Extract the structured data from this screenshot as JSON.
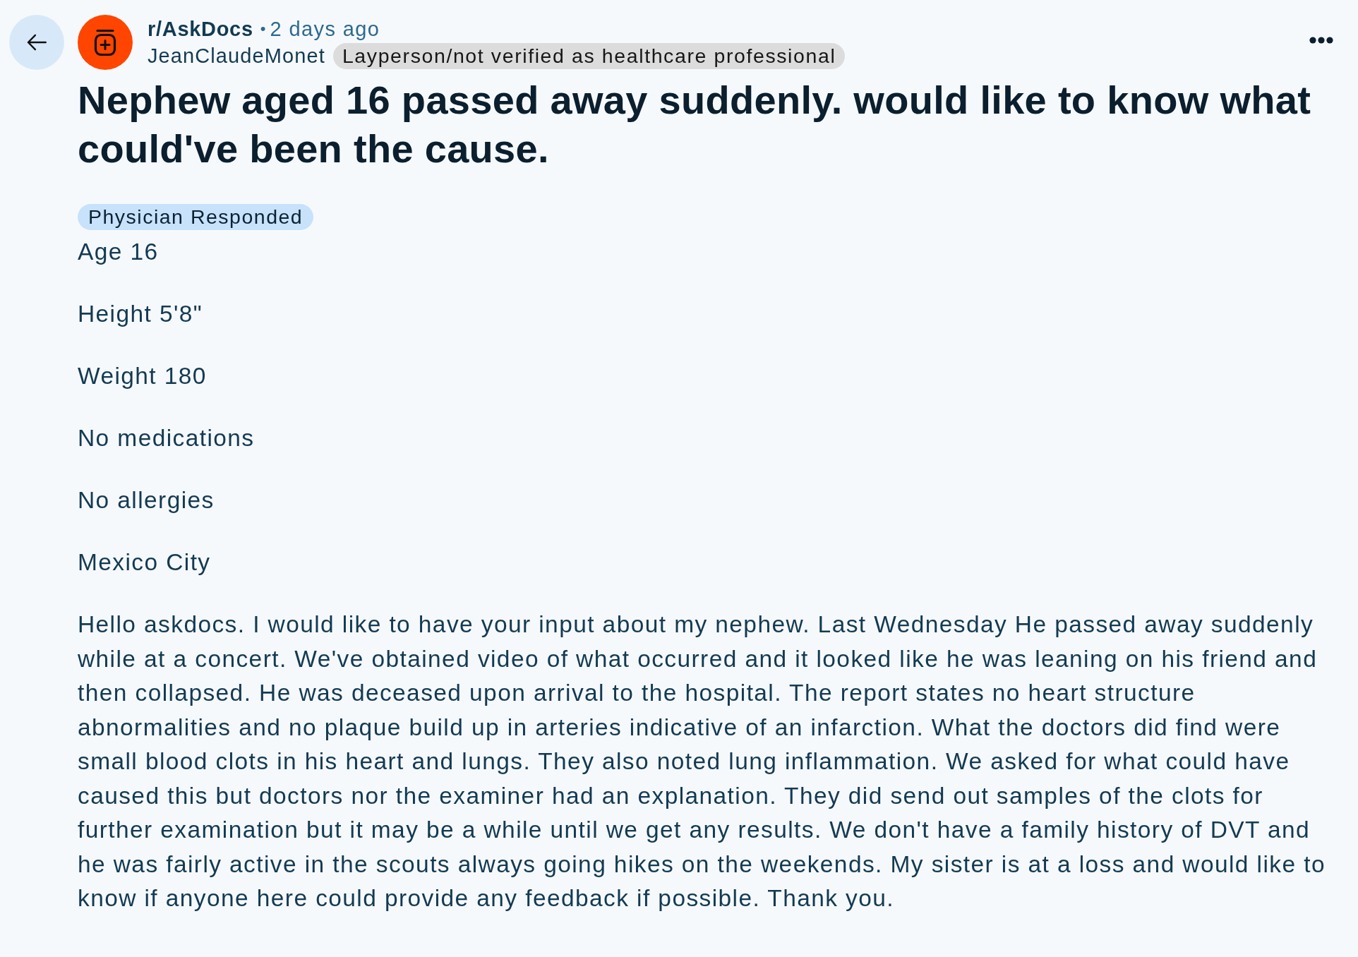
{
  "header": {
    "subreddit": "r/AskDocs",
    "separator": "•",
    "time": "2 days ago",
    "author": "JeanClaudeMonet",
    "author_flair": "Layperson/not verified as healthcare professional"
  },
  "post": {
    "title": "Nephew aged 16 passed away suddenly. would like to know what could've been the cause.",
    "post_flair": "Physician Responded",
    "body": [
      "Age 16",
      "Height 5'8\"",
      "Weight 180",
      "No medications",
      "No allergies",
      "Mexico City",
      "Hello askdocs. I would like to have your input about my nephew. Last Wednesday He passed away suddenly while at a concert. We've obtained video of what occurred and it looked like he was leaning on his friend and then collapsed. He was deceased upon arrival to the hospital. The report states no heart structure abnormalities and no plaque build up in arteries indicative of an infarction. What the doctors did find were small blood clots in his heart and lungs. They also noted lung inflammation. We asked for what could have caused this but doctors nor the examiner had an explanation. They did send out samples of the clots for further examination but it may be a while until we get any results. We don't have a family history of DVT and he was fairly active in the scouts always going hikes on the weekends. My sister is at a loss and would like to know if anyone here could provide any feedback if possible. Thank you."
    ]
  }
}
